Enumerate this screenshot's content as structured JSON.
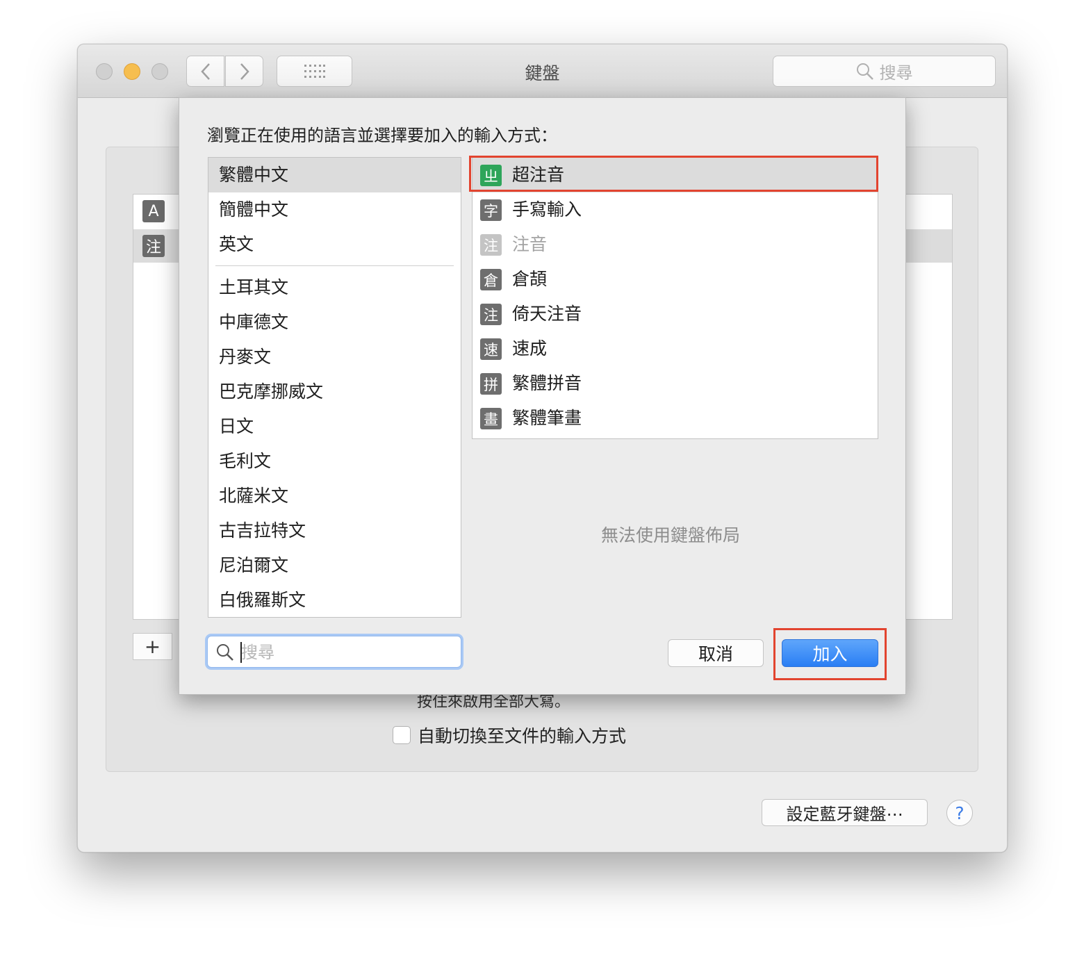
{
  "window": {
    "title": "鍵盤",
    "search_placeholder": "搜尋",
    "nav_back_icon": "chevron-left-icon",
    "nav_forward_icon": "chevron-right-icon",
    "grid_icon": "grid-icon"
  },
  "background": {
    "input_sources": [
      {
        "icon": "A",
        "label": "A"
      },
      {
        "icon": "注",
        "label": "注"
      }
    ],
    "add_label": "+",
    "caps_text": "按住來啟用全部大寫。",
    "auto_switch_label": "自動切換至文件的輸入方式",
    "bluetooth_button": "設定藍牙鍵盤⋯",
    "help_label": "?"
  },
  "dialog": {
    "prompt": "瀏覽正在使用的語言並選擇要加入的輸入方式：",
    "languages_top": [
      "繁體中文",
      "簡體中文",
      "英文"
    ],
    "languages_rest": [
      "土耳其文",
      "中庫德文",
      "丹麥文",
      "巴克摩挪威文",
      "日文",
      "毛利文",
      "北薩米文",
      "古吉拉特文",
      "尼泊爾文",
      "白俄羅斯文"
    ],
    "selected_language": "繁體中文",
    "input_methods": [
      {
        "icon": "ㄓ",
        "label": "超注音",
        "selected": true,
        "color": "#2ea55a"
      },
      {
        "icon": "字",
        "label": "手寫輸入"
      },
      {
        "icon": "注",
        "label": "注音",
        "disabled": true
      },
      {
        "icon": "倉",
        "label": "倉頡"
      },
      {
        "icon": "注",
        "label": "倚天注音"
      },
      {
        "icon": "速",
        "label": "速成"
      },
      {
        "icon": "拼",
        "label": "繁體拼音"
      },
      {
        "icon": "畫",
        "label": "繁體筆畫"
      }
    ],
    "no_layout_text": "無法使用鍵盤佈局",
    "search_placeholder": "搜尋",
    "cancel_label": "取消",
    "add_label": "加入",
    "highlight_color": "#e2442f",
    "accent_color": "#2a7ef4"
  }
}
